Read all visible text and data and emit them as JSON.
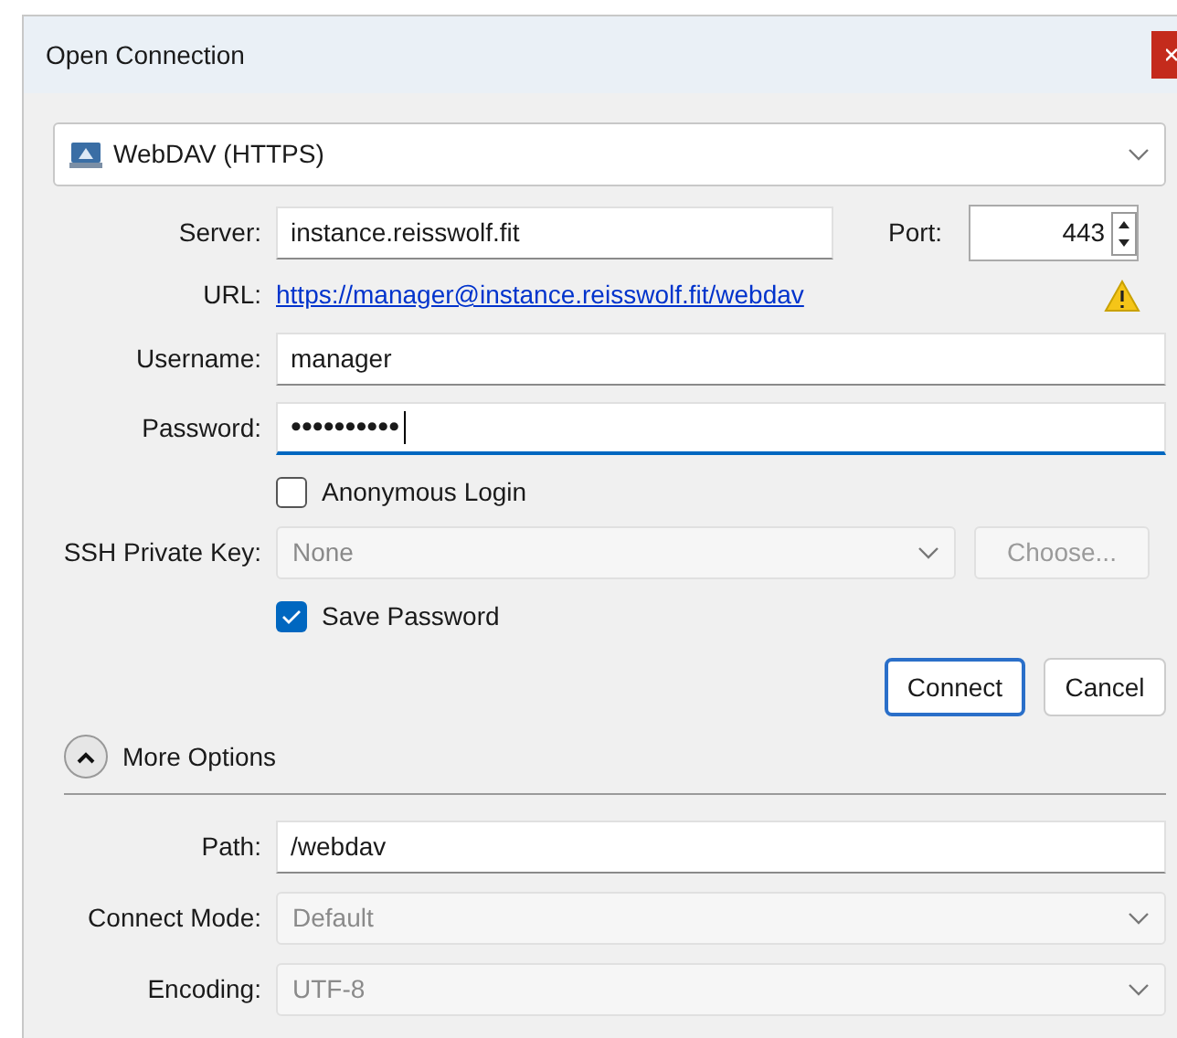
{
  "window": {
    "title": "Open Connection"
  },
  "protocol": {
    "value": "WebDAV (HTTPS)"
  },
  "server": {
    "label": "Server:",
    "value": "instance.reisswolf.fit"
  },
  "port": {
    "label": "Port:",
    "value": "443"
  },
  "url": {
    "label": "URL:",
    "link": "https://manager@instance.reisswolf.fit/webdav",
    "warning": true
  },
  "username": {
    "label": "Username:",
    "value": "manager"
  },
  "password": {
    "label": "Password:",
    "value": "••••••••••",
    "focused": true
  },
  "anonymous_login": {
    "label": "Anonymous Login",
    "checked": false
  },
  "ssh_private_key": {
    "label": "SSH Private Key:",
    "value": "None",
    "disabled": true,
    "button": "Choose...",
    "button_disabled": true
  },
  "save_password": {
    "label": "Save Password",
    "checked": true
  },
  "buttons": [
    {
      "label": "Connect",
      "default": true
    },
    {
      "label": "Cancel",
      "default": false
    }
  ],
  "more_options": {
    "label": "More Options",
    "expanded": true
  },
  "options": [
    {
      "label": "Path:",
      "kind": "field",
      "value": "/webdav",
      "disabled": false
    },
    {
      "label": "Connect Mode:",
      "kind": "dropdown",
      "value": "Default",
      "disabled": true
    },
    {
      "label": "Encoding:",
      "kind": "dropdown",
      "value": "UTF-8",
      "disabled": true
    }
  ]
}
